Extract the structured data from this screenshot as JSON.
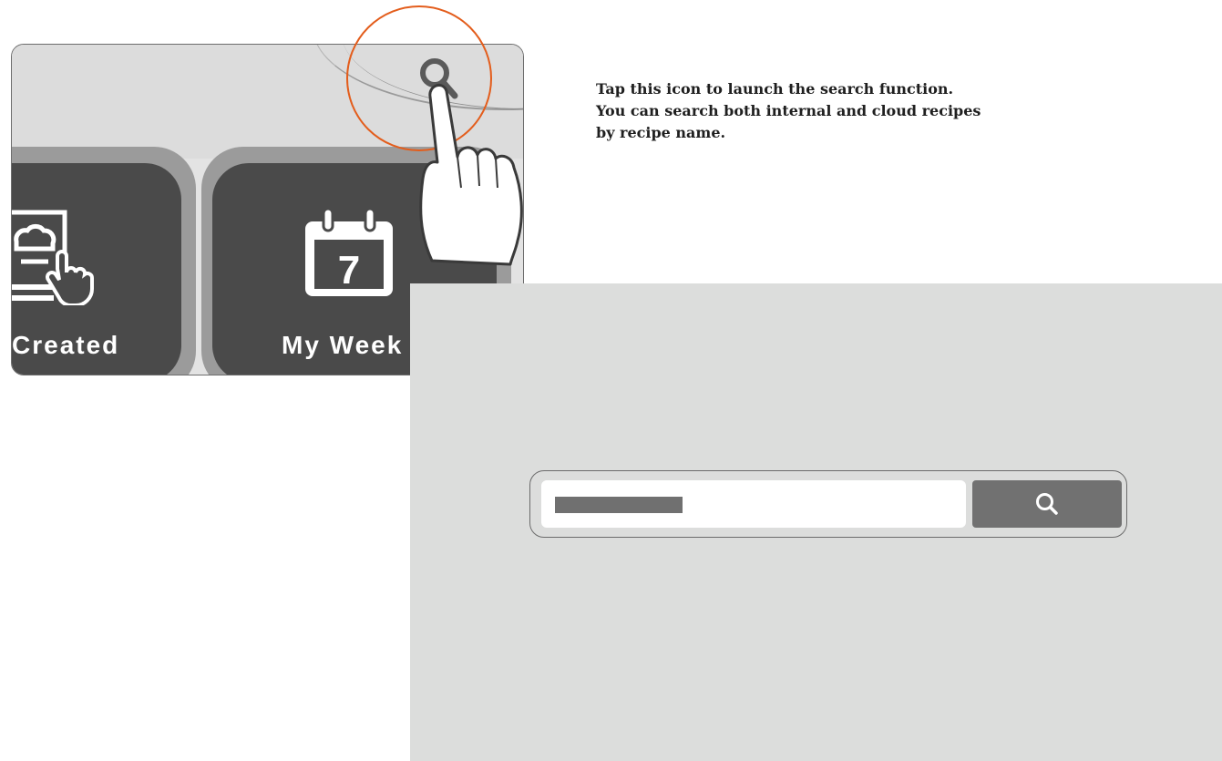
{
  "screen": {
    "tiles": [
      {
        "label": "Created",
        "icon": "created-recipe-icon"
      },
      {
        "label": "My Week",
        "icon": "calendar-icon",
        "calendar_day": "7"
      }
    ],
    "search_icon": "search-icon"
  },
  "instruction": {
    "lines": [
      "Tap this icon to launch the search function.",
      "You can search both internal and cloud recipes",
      "by recipe name."
    ]
  },
  "search_panel": {
    "input_value": "",
    "button_icon": "search-icon"
  },
  "colors": {
    "highlight": "#e35d1c",
    "tile": "#4a4a4a",
    "panel": "#dcdddc",
    "button": "#717171"
  }
}
